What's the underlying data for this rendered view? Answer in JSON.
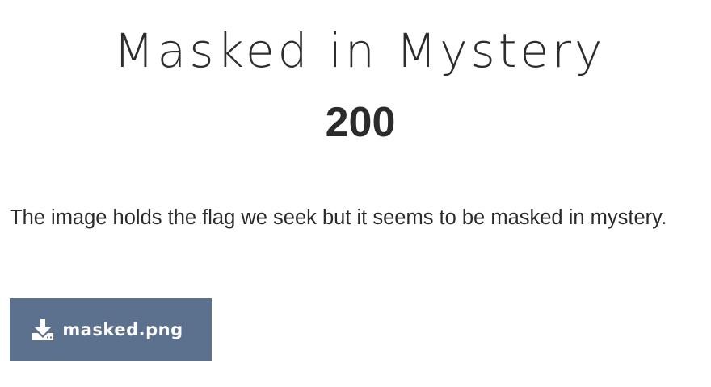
{
  "challenge": {
    "title": "Masked in Mystery",
    "points": "200",
    "description": "The image holds the flag we seek but it seems to be masked in mystery.",
    "file": {
      "name": "masked.png",
      "icon": "download-icon",
      "button_color": "#5b718e"
    }
  }
}
